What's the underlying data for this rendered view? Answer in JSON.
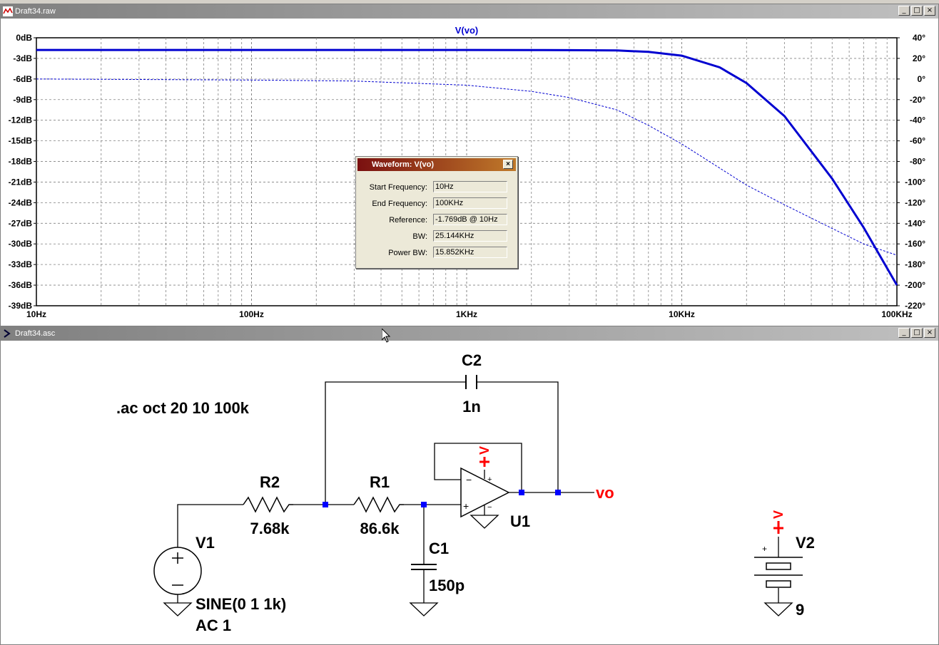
{
  "waveform_window": {
    "title": "Draft34.raw",
    "trace_name": "V(vo)",
    "left_axis_labels": [
      "0dB",
      "-3dB",
      "-6dB",
      "-9dB",
      "-12dB",
      "-15dB",
      "-18dB",
      "-21dB",
      "-24dB",
      "-27dB",
      "-30dB",
      "-33dB",
      "-36dB",
      "-39dB"
    ],
    "right_axis_labels": [
      "40°",
      "20°",
      "0°",
      "-20°",
      "-40°",
      "-60°",
      "-80°",
      "-100°",
      "-120°",
      "-140°",
      "-160°",
      "-180°",
      "-200°",
      "-220°"
    ],
    "x_axis_labels": [
      "10Hz",
      "100Hz",
      "1KHz",
      "10KHz",
      "100KHz"
    ],
    "trace_color": "#0000d0"
  },
  "chart_data": {
    "type": "line",
    "x_scale": "log",
    "xlim": [
      10,
      100000
    ],
    "ylim": [
      -39,
      0
    ],
    "y2lim": [
      -220,
      40
    ],
    "series": [
      {
        "name": "V(vo)",
        "axis": "magnitude_dB",
        "x": [
          10,
          100,
          1000,
          2000,
          3000,
          5000,
          7000,
          10000,
          15000,
          20000,
          30000,
          50000,
          70000,
          100000
        ],
        "values": [
          -1.77,
          -1.77,
          -1.77,
          -1.78,
          -1.8,
          -1.85,
          -2.05,
          -2.6,
          -4.3,
          -6.6,
          -11.4,
          -20.5,
          -27.6,
          -36
        ]
      },
      {
        "name": "V(vo) phase",
        "axis": "phase_deg",
        "x": [
          10,
          100,
          300,
          1000,
          2000,
          3000,
          5000,
          7000,
          10000,
          20000,
          30000,
          50000,
          70000,
          100000
        ],
        "values": [
          0,
          -1,
          -2,
          -6,
          -12,
          -18,
          -30,
          -45,
          -63,
          -103,
          -122,
          -145,
          -160,
          -171
        ]
      }
    ]
  },
  "measure_dialog": {
    "title": "Waveform: V(vo)",
    "rows": [
      {
        "label": "Start Frequency:",
        "value": "10Hz"
      },
      {
        "label": "End Frequency:",
        "value": "100KHz"
      },
      {
        "label": "Reference:",
        "value": "-1.769dB @ 10Hz"
      },
      {
        "label": "BW:",
        "value": "25.144KHz"
      },
      {
        "label": "Power BW:",
        "value": "15.852KHz"
      }
    ]
  },
  "schematic_window": {
    "title": "Draft34.asc",
    "directive": ".ac oct 20 10 100k",
    "components": {
      "c2_name": "C2",
      "c2_value": "1n",
      "r2_name": "R2",
      "r2_value": "7.68k",
      "r1_name": "R1",
      "r1_value": "86.6k",
      "c1_name": "C1",
      "c1_value": "150p",
      "u1_name": "U1",
      "v1_name": "V1",
      "v1_value": "SINE(0 1 1k)",
      "v1_ac": "AC 1",
      "v2_name": "V2",
      "v2_value": "9",
      "net_vo": "vo",
      "supply_label": "V"
    },
    "wire_color": "#000000",
    "node_color": "#0000ff",
    "net_label_color": "#ff0000"
  },
  "window_buttons": {
    "minimize": "_",
    "maximize": "□",
    "close": "×"
  }
}
